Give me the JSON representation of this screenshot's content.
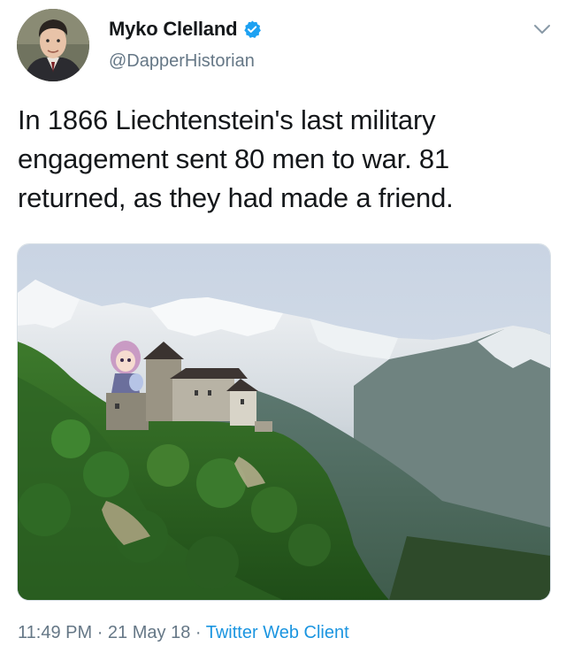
{
  "tweet": {
    "display_name": "Myko Clelland",
    "handle": "@DapperHistorian",
    "verified": true,
    "text": "In 1866 Liechtenstein's last military engagement sent 80 men to war. 81 returned, as they had made a friend.",
    "time": "11:49 PM",
    "date": "21 May 18",
    "separator": "·",
    "source": "Twitter Web Client"
  },
  "icons": {
    "verified": "verified-badge-icon",
    "menu": "chevron-down-icon"
  },
  "colors": {
    "text": "#14171a",
    "secondary": "#657786",
    "link": "#1b95e0",
    "verified": "#1da1f2"
  }
}
